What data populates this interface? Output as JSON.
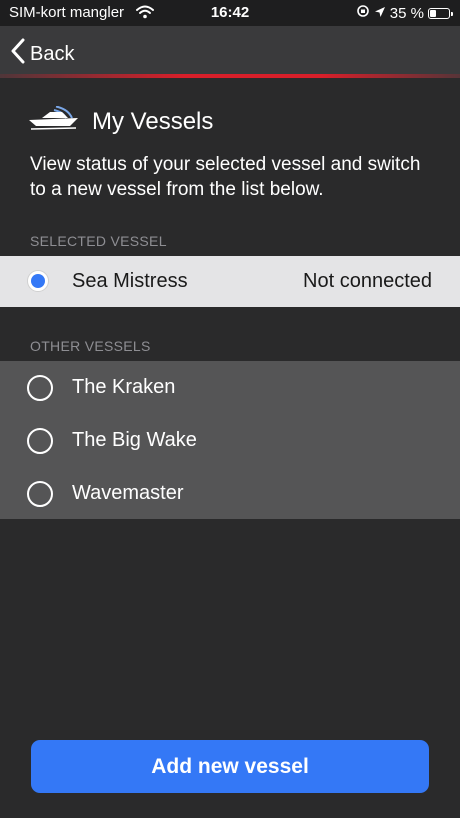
{
  "status_bar": {
    "carrier": "SIM-kort mangler",
    "time": "16:42",
    "battery": "35 %"
  },
  "nav": {
    "back_label": "Back"
  },
  "header": {
    "title": "My Vessels",
    "icon": "boat-icon",
    "description": "View status of your selected vessel and switch to a new vessel from the list below."
  },
  "selected_section": {
    "label": "SELECTED VESSEL",
    "vessel": {
      "name": "Sea Mistress",
      "status": "Not connected"
    }
  },
  "other_section": {
    "label": "OTHER VESSELS",
    "vessels": [
      {
        "name": "The Kraken"
      },
      {
        "name": "The Big Wake"
      },
      {
        "name": "Wavemaster"
      }
    ]
  },
  "actions": {
    "add_label": "Add new vessel"
  },
  "colors": {
    "accent": "#3478f6",
    "brand_red": "#d81f2a",
    "background": "#2a2a2b"
  }
}
